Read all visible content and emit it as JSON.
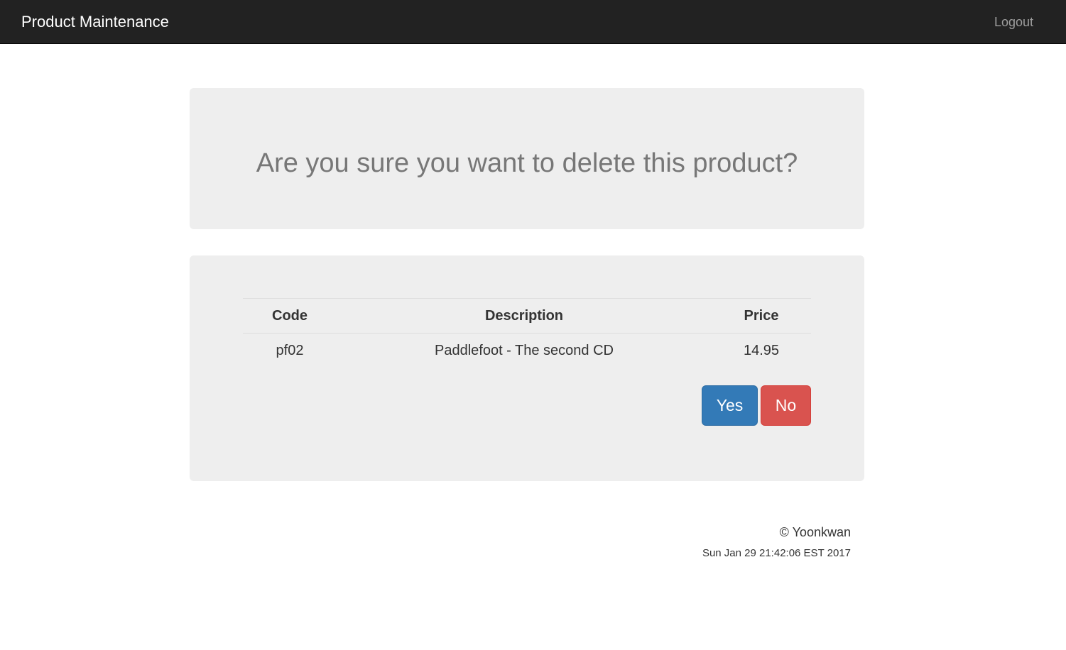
{
  "navbar": {
    "brand": "Product Maintenance",
    "logout_label": "Logout",
    "background": "#222222"
  },
  "confirm": {
    "question": "Are you sure you want to delete this product?"
  },
  "product_table": {
    "headers": {
      "code": "Code",
      "description": "Description",
      "price": "Price"
    },
    "rows": [
      {
        "code": "pf02",
        "description": "Paddlefoot - The second CD",
        "price": "14.95"
      }
    ]
  },
  "actions": {
    "yes_label": "Yes",
    "no_label": "No",
    "yes_color": "#337ab7",
    "no_color": "#d9534f"
  },
  "footer": {
    "author": "© Yoonkwan",
    "date": "Sun Jan 29 21:42:06 EST 2017"
  }
}
